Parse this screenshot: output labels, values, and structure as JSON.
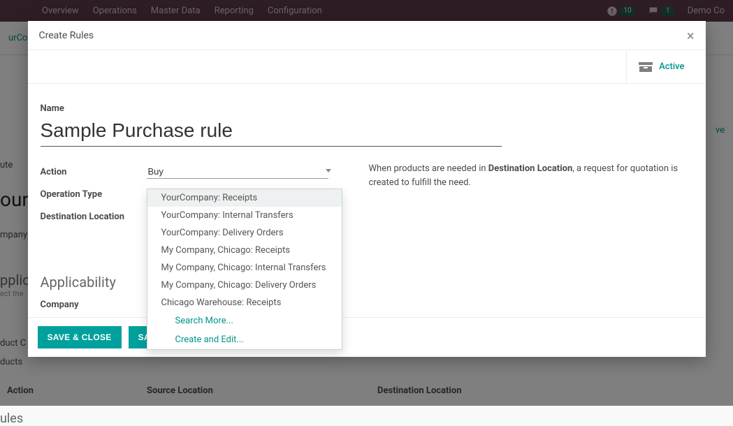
{
  "topnav": {
    "items": [
      "Overview",
      "Operations",
      "Master Data",
      "Reporting",
      "Configuration"
    ],
    "activity_count": "10",
    "discuss_count": "1",
    "user": "Demo Co"
  },
  "background": {
    "breadcrumb_partial": "urCo",
    "route_label": "ute",
    "route_value": "our",
    "company_label": "mpany",
    "applicability_heading_partial": "pplica",
    "applicability_help_partial": "ect the",
    "productcat_partial": "duct C",
    "products_partial": "ducts",
    "rules_heading_partial": "ules",
    "th_action": "Action",
    "th_source": "Source Location",
    "th_dest": "Destination Location",
    "active_text": "ve"
  },
  "modal": {
    "title": "Create Rules",
    "active_label": "Active",
    "name_label": "Name",
    "name_value": "Sample Purchase rule",
    "action_label": "Action",
    "action_value": "Buy",
    "optype_label": "Operation Type",
    "optype_value": "",
    "destloc_label": "Destination Location",
    "help_text_prefix": "When products are needed in ",
    "help_text_bold": "Destination Location",
    "help_text_suffix": ", a request for quotation is created to fulfill the need.",
    "section_applicability": "Applicability",
    "company_label": "Company",
    "footer": {
      "save_close": "SAVE & CLOSE",
      "save_new_partial": "SAVE & "
    }
  },
  "dropdown": {
    "options": [
      "YourCompany: Receipts",
      "YourCompany: Internal Transfers",
      "YourCompany: Delivery Orders",
      "My Company, Chicago: Receipts",
      "My Company, Chicago: Internal Transfers",
      "My Company, Chicago: Delivery Orders",
      "Chicago Warehouse: Receipts"
    ],
    "search_more": "Search More...",
    "create_edit": "Create and Edit..."
  }
}
